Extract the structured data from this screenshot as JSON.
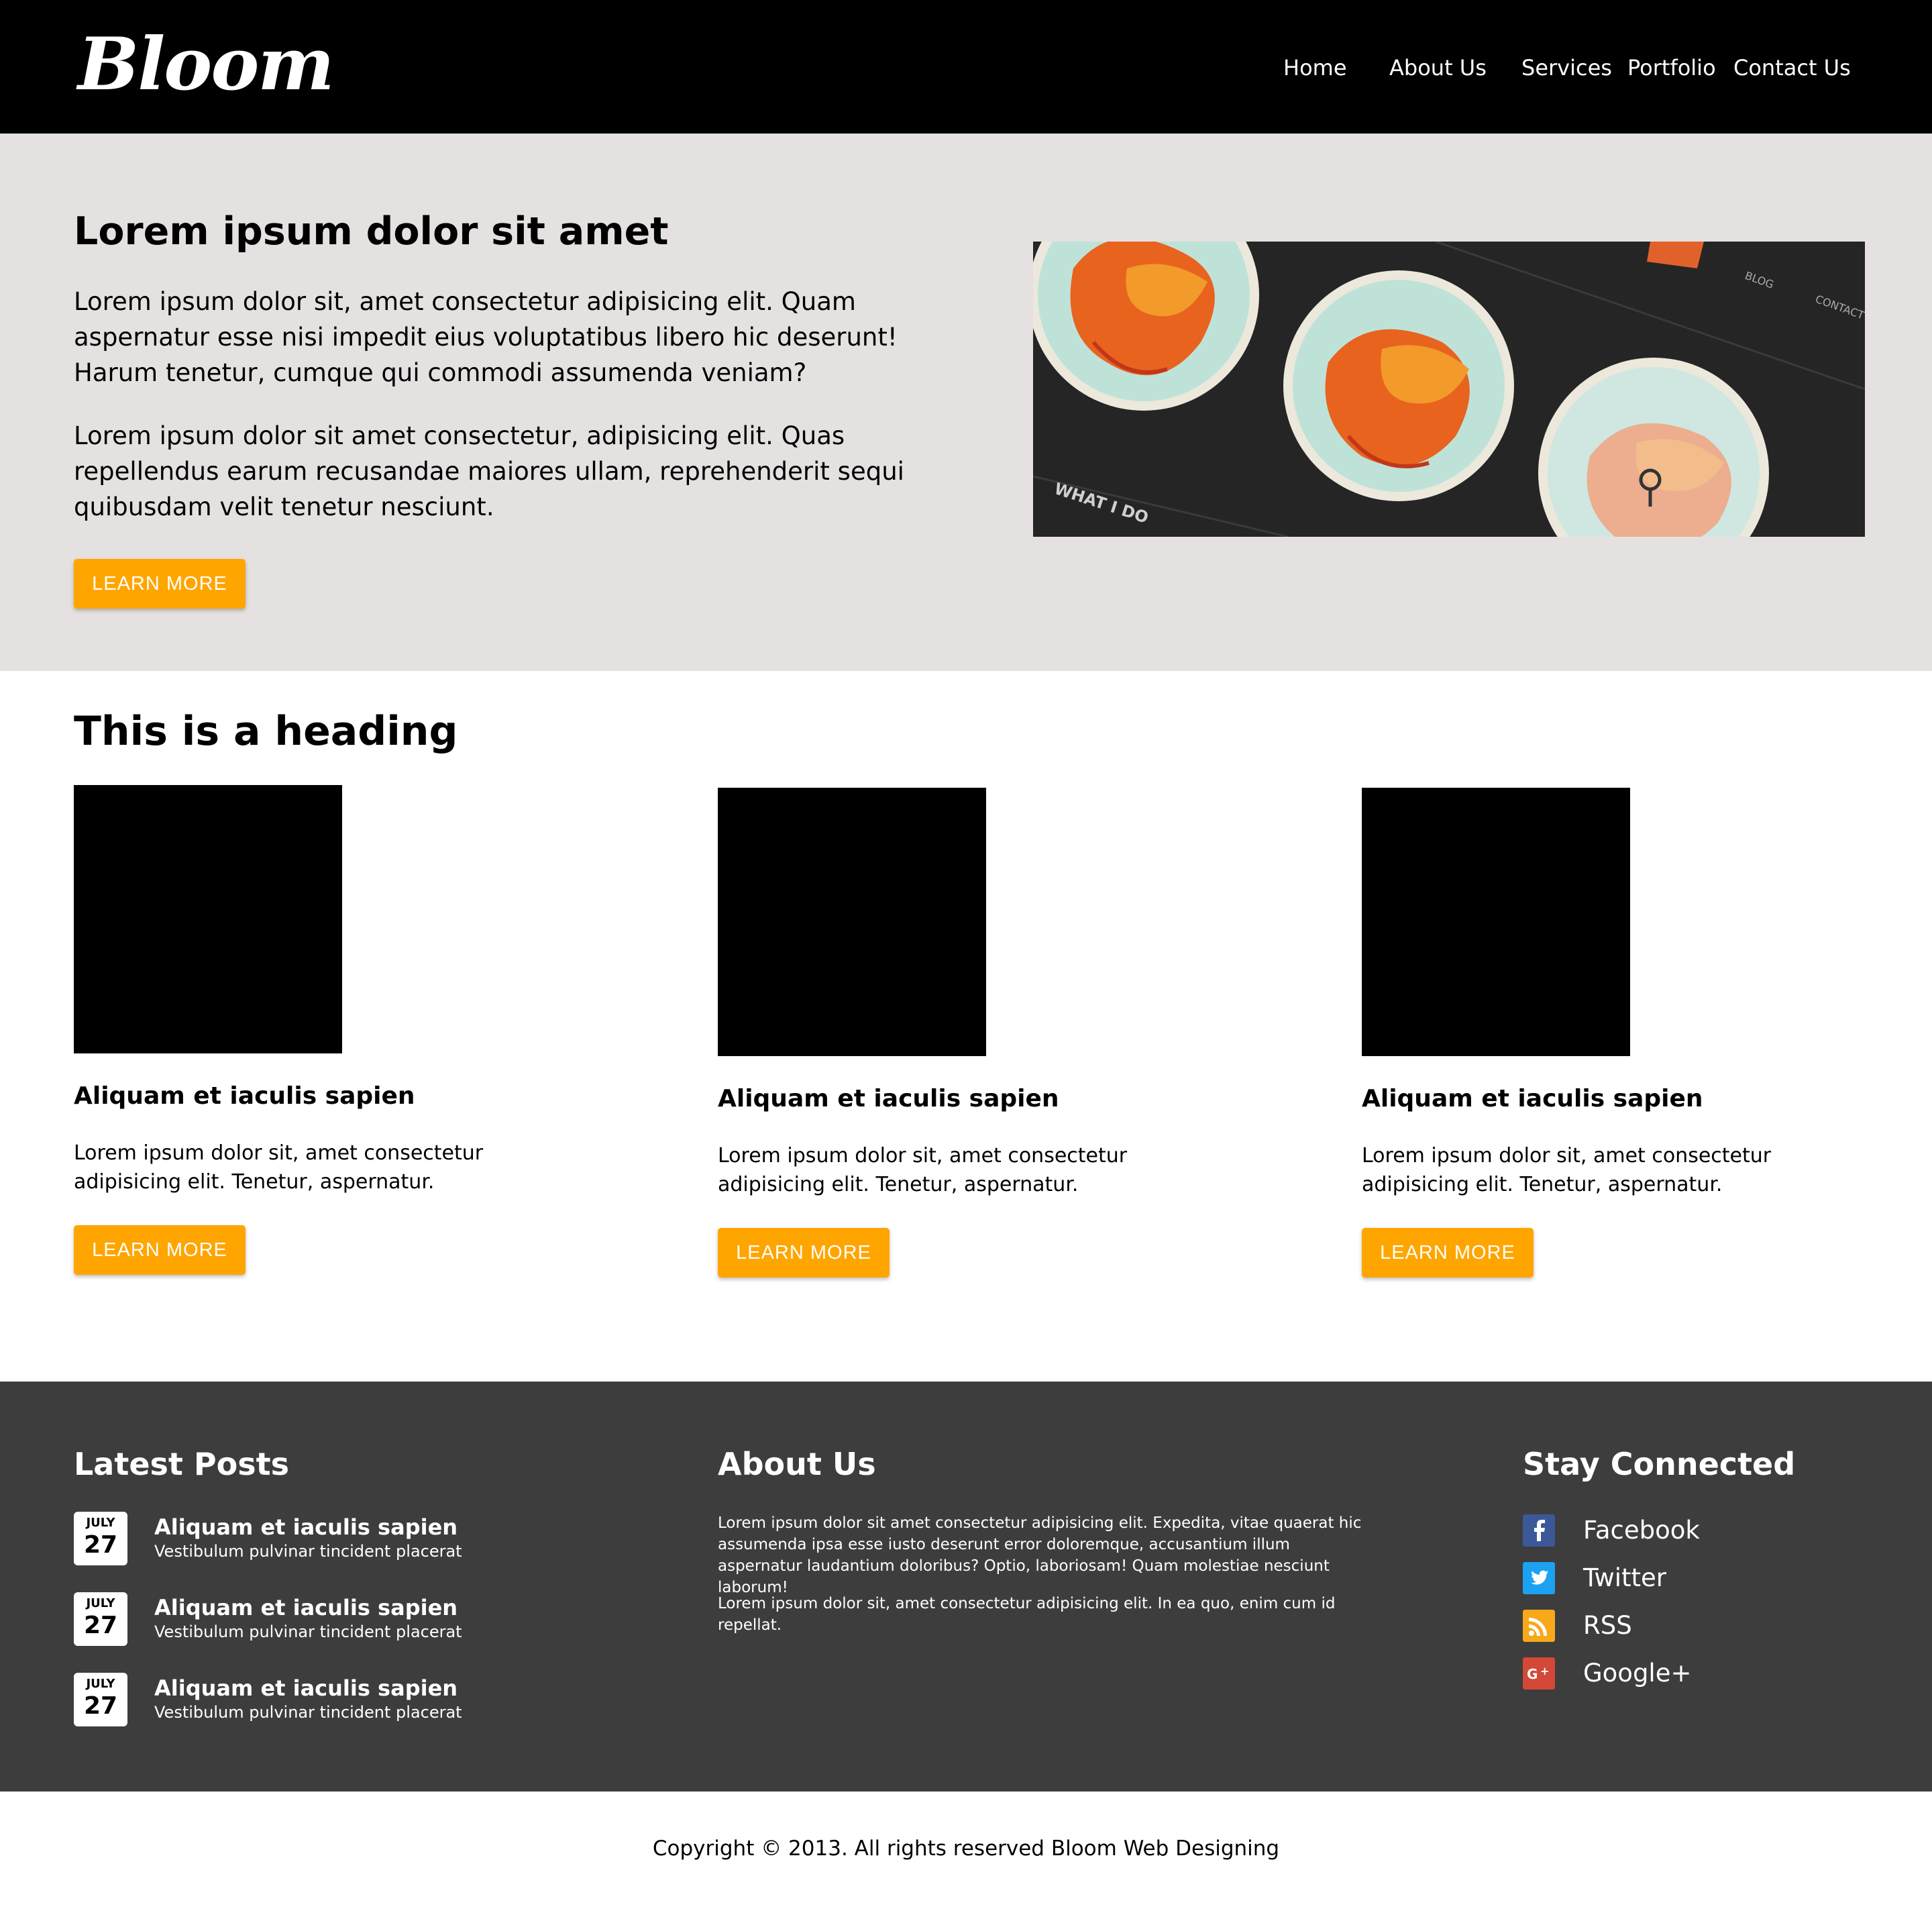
{
  "header": {
    "logo": "Bloom",
    "nav": [
      "Home",
      "About Us",
      "Services",
      "Portfolio",
      "Contact Us"
    ]
  },
  "hero": {
    "title": "Lorem ipsum dolor sit amet",
    "paragraphs": [
      "Lorem ipsum dolor sit, amet consectetur adipisicing elit. Quam aspernatur esse nisi impedit eius voluptatibus libero hic deserunt! Harum tenetur, cumque qui commodi assumenda veniam?",
      "Lorem ipsum dolor sit amet consectetur, adipisicing elit. Quas repellendus earum recusandae maiores ullam, reprehenderit sequi quibusdam velit tenetur nesciunt."
    ],
    "button": "LEARN MORE",
    "image_text": {
      "what_i_do": "WHAT I DO",
      "blog": "BLOG",
      "contact": "CONTACT"
    }
  },
  "features": {
    "heading": "This is a heading",
    "cards": [
      {
        "title": "Aliquam et iaculis sapien",
        "text": "Lorem ipsum dolor sit, amet consectetur adipisicing elit. Tenetur, aspernatur.",
        "button": "LEARN MORE"
      },
      {
        "title": "Aliquam et iaculis sapien",
        "text": "Lorem ipsum dolor sit, amet consectetur adipisicing elit. Tenetur, aspernatur.",
        "button": "LEARN MORE"
      },
      {
        "title": "Aliquam et iaculis sapien",
        "text": "Lorem ipsum dolor sit, amet consectetur adipisicing elit. Tenetur, aspernatur.",
        "button": "LEARN MORE"
      }
    ]
  },
  "footer": {
    "latest_posts": {
      "heading": "Latest Posts",
      "posts": [
        {
          "month": "JULY",
          "day": "27",
          "title": "Aliquam et iaculis sapien",
          "subtitle": "Vestibulum pulvinar tincident placerat"
        },
        {
          "month": "JULY",
          "day": "27",
          "title": "Aliquam et iaculis sapien",
          "subtitle": "Vestibulum pulvinar tincident placerat"
        },
        {
          "month": "JULY",
          "day": "27",
          "title": "Aliquam et iaculis sapien",
          "subtitle": "Vestibulum pulvinar tincident placerat"
        }
      ]
    },
    "about": {
      "heading": "About Us",
      "paragraphs": [
        "Lorem ipsum dolor sit amet consectetur adipisicing elit. Expedita, vitae quaerat hic assumenda ipsa esse iusto deserunt error doloremque, accusantium illum aspernatur laudantium doloribus? Optio, laboriosam! Quam molestiae nesciunt laborum!",
        "Lorem ipsum dolor sit, amet consectetur adipisicing elit. In ea quo, enim cum id repellat."
      ]
    },
    "connected": {
      "heading": "Stay Connected",
      "links": [
        {
          "label": "Facebook",
          "icon": "facebook-icon",
          "color": "#3b5998"
        },
        {
          "label": "Twitter",
          "icon": "twitter-icon",
          "color": "#1da1f2"
        },
        {
          "label": "RSS",
          "icon": "rss-icon",
          "color": "#f7a81b"
        },
        {
          "label": "Google+",
          "icon": "google-plus-icon",
          "color": "#d34836"
        }
      ]
    }
  },
  "copyright": "Copyright © 2013. All rights reserved Bloom Web Designing",
  "colors": {
    "accent": "#ffa500",
    "header_bg": "#000000",
    "hero_bg": "#e6e1e1",
    "footer_bg": "#3d3d3d"
  }
}
